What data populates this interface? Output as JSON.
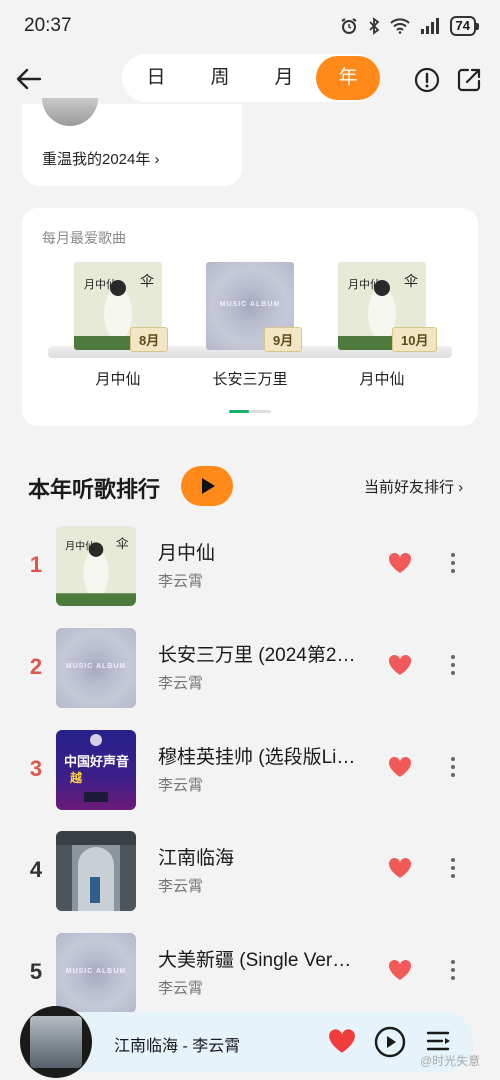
{
  "status": {
    "time": "20:37",
    "battery": "74"
  },
  "tabs": [
    "日",
    "周",
    "月",
    "年"
  ],
  "active_tab": "年",
  "recap": {
    "label": "重温我的2024年 ›"
  },
  "monthly": {
    "title": "每月最爱歌曲",
    "items": [
      {
        "month": "8月",
        "name": "月中仙",
        "cover": "moon"
      },
      {
        "month": "9月",
        "name": "长安三万里",
        "cover": "grey",
        "cover_text": "MUSIC ALBUM"
      },
      {
        "month": "10月",
        "name": "月中仙",
        "cover": "moon"
      }
    ]
  },
  "ranking": {
    "title": "本年听歌排行",
    "friends_label": "当前好友排行 ›",
    "songs": [
      {
        "rank": "1",
        "name": "月中仙",
        "artist": "李云霄",
        "rank_color": "#e0554e",
        "cover": "moon"
      },
      {
        "rank": "2",
        "name": "长安三万里 (2024第2…",
        "artist": "李云霄",
        "rank_color": "#e0554e",
        "cover": "grey",
        "cover_text": "MUSIC ALBUM"
      },
      {
        "rank": "3",
        "name": "穆桂英挂帅 (选段版Li…",
        "artist": "李云霄",
        "rank_color": "#e0554e",
        "cover": "voice",
        "cover_text": "中国好声音"
      },
      {
        "rank": "4",
        "name": "江南临海",
        "artist": "李云霄",
        "rank_color": "#333333",
        "cover": "jiangnan"
      },
      {
        "rank": "5",
        "name": "大美新疆 (Single Ver…",
        "artist": "李云霄",
        "rank_color": "#333333",
        "cover": "grey",
        "cover_text": "MUSIC ALBUM"
      }
    ]
  },
  "player": {
    "title": "江南临海 - 李云霄"
  },
  "watermark": "@时光失意",
  "colors": {
    "accent": "#ff8a1a",
    "heart": "#f25a5a",
    "indicator": "#15b36a"
  }
}
